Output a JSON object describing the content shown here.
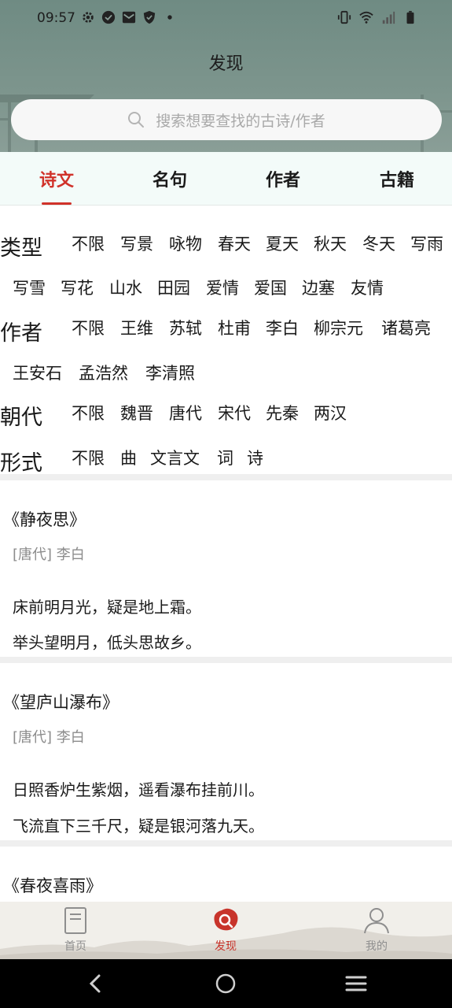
{
  "status_bar": {
    "time": "09:57"
  },
  "header": {
    "title": "发现",
    "search_placeholder": "搜索想要查找的古诗/作者"
  },
  "tabs": [
    {
      "label": "诗文",
      "active": true
    },
    {
      "label": "名句",
      "active": false
    },
    {
      "label": "作者",
      "active": false
    },
    {
      "label": "古籍",
      "active": false
    }
  ],
  "filters": {
    "type": {
      "label": "类型",
      "options": [
        "不限",
        "写景",
        "咏物",
        "春天",
        "夏天",
        "秋天",
        "冬天",
        "写雨",
        "写雪",
        "写花",
        "山水",
        "田园",
        "爱情",
        "爱国",
        "边塞",
        "友情"
      ]
    },
    "author": {
      "label": "作者",
      "options": [
        "不限",
        "王维",
        "苏轼",
        "杜甫",
        "李白",
        "柳宗元",
        "诸葛亮",
        "王安石",
        "孟浩然",
        "李清照"
      ]
    },
    "dynasty": {
      "label": "朝代",
      "options": [
        "不限",
        "魏晋",
        "唐代",
        "宋代",
        "先秦",
        "两汉"
      ]
    },
    "form": {
      "label": "形式",
      "options": [
        "不限",
        "曲",
        "文言文",
        "词",
        "诗"
      ]
    }
  },
  "poems": [
    {
      "title": "《静夜思》",
      "author": "[唐代] 李白",
      "lines": [
        "床前明月光，疑是地上霜。",
        "举头望明月，低头思故乡。"
      ]
    },
    {
      "title": "《望庐山瀑布》",
      "author": "[唐代] 李白",
      "lines": [
        "日照香炉生紫烟，遥看瀑布挂前川。",
        "飞流直下三千尺，疑是银河落九天。"
      ]
    },
    {
      "title": "《春夜喜雨》",
      "author": "",
      "lines": []
    }
  ],
  "bottom_nav": [
    {
      "label": "首页",
      "icon": "book-icon",
      "active": false
    },
    {
      "label": "发现",
      "icon": "discover-search-icon",
      "active": true
    },
    {
      "label": "我的",
      "icon": "user-icon",
      "active": false
    }
  ],
  "colors": {
    "accent": "#d0322a",
    "header_bg": "#7d958d",
    "tabs_bg": "#f3fbf9"
  }
}
